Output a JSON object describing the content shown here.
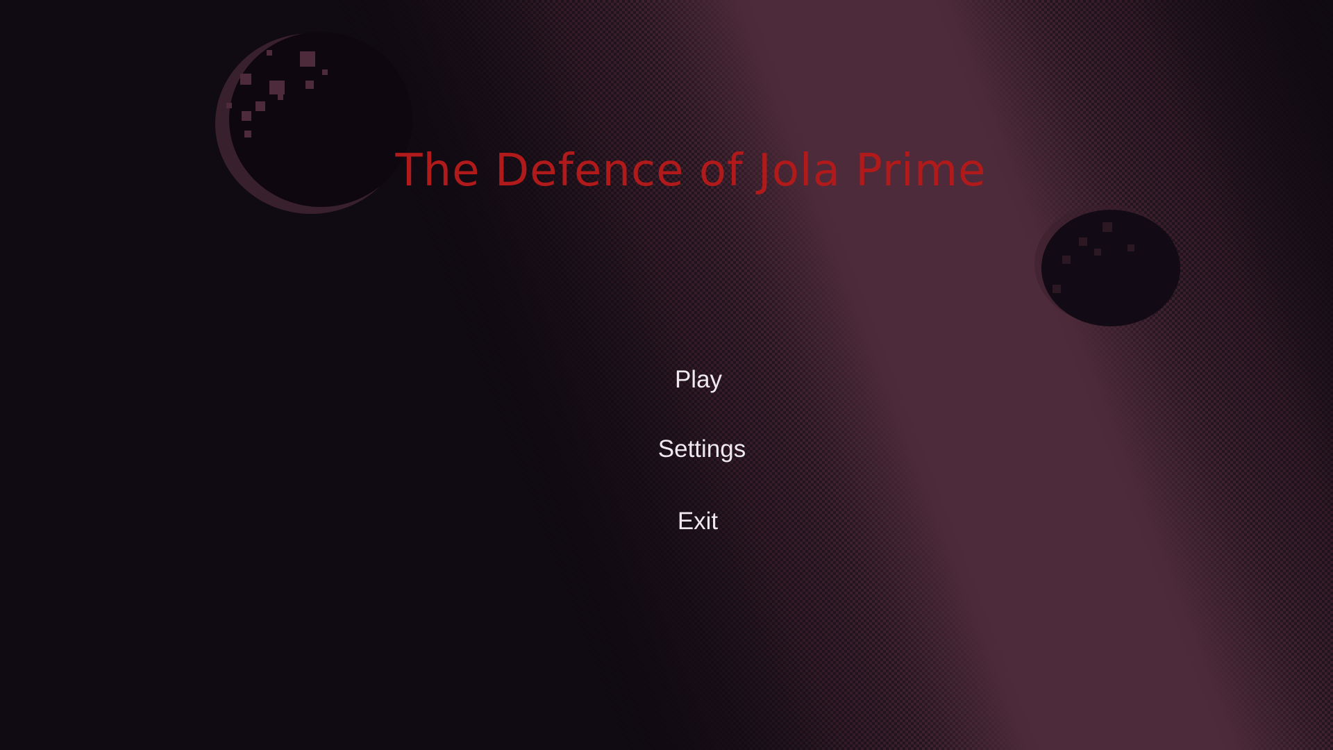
{
  "game": {
    "title": "The Defence of Jola Prime"
  },
  "menu": {
    "play_label": "Play",
    "settings_label": "Settings",
    "exit_label": "Exit"
  },
  "colors": {
    "background": "#100a12",
    "nebula": "#4e2b3a",
    "planet": "#0e0710",
    "title": "#b01a1a",
    "menu_text": "#efe9ef"
  },
  "background_elements": [
    "pixel-nebula-band",
    "large-planet",
    "distant-planet"
  ]
}
